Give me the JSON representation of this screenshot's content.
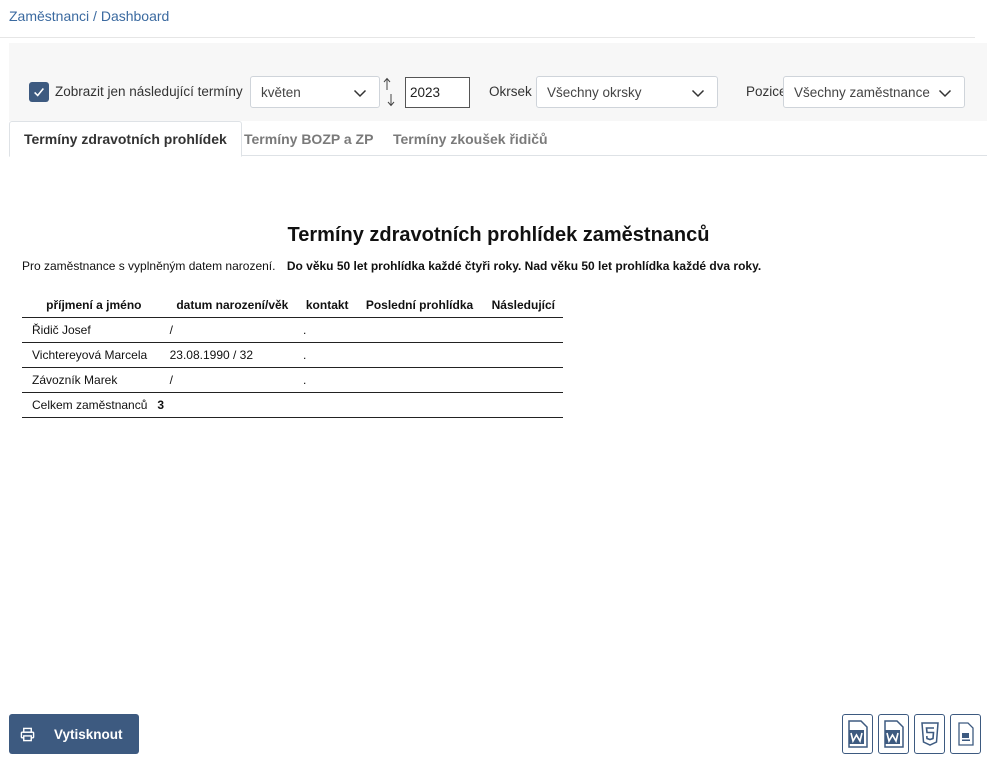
{
  "breadcrumb": {
    "parent": "Zaměstnanci",
    "separator": "/",
    "current": "Dashboard"
  },
  "filters": {
    "only_upcoming_label": "Zobrazit jen následující termíny",
    "only_upcoming_checked": true,
    "month_value": "květen",
    "year_value": "2023",
    "okrsek_label": "Okrsek",
    "okrsek_value": "Všechny okrsky",
    "pozice_label": "Pozice",
    "pozice_value": "Všechny zaměstnance"
  },
  "tabs": [
    {
      "label": "Termíny zdravotních prohlídek",
      "active": true
    },
    {
      "label": "Termíny BOZP a ZP",
      "active": false
    },
    {
      "label": "Termíny zkoušek řidičů",
      "active": false
    }
  ],
  "report": {
    "title": "Termíny zdravotních prohlídek zaměstnanců",
    "note_normal": "Pro zaměstnance s vyplněným datem narození.",
    "note_bold": "Do věku 50 let prohlídka každé čtyři roky. Nad věku 50 let prohlídka každé dva roky.",
    "columns": [
      "příjmení a jméno",
      "datum narození/věk",
      "kontakt",
      "Poslední prohlídka",
      "Následující"
    ],
    "rows": [
      {
        "name": "Řidič Josef",
        "birth": "/",
        "contact": ".",
        "last": "",
        "next": ""
      },
      {
        "name": "Vichtereyová Marcela",
        "birth": "23.08.1990 / 32",
        "contact": ".",
        "last": "",
        "next": ""
      },
      {
        "name": "Závozník Marek",
        "birth": "/",
        "contact": ".",
        "last": "",
        "next": ""
      }
    ],
    "total_label": "Celkem zaměstnanců",
    "total_value": "3"
  },
  "actions": {
    "print_label": "Vytisknout",
    "export_icons": [
      "word-doc-icon",
      "word-docx-icon",
      "html5-icon",
      "pdf-icon"
    ]
  },
  "colors": {
    "accent": "#3d5a80",
    "link": "#3b6aa0"
  }
}
